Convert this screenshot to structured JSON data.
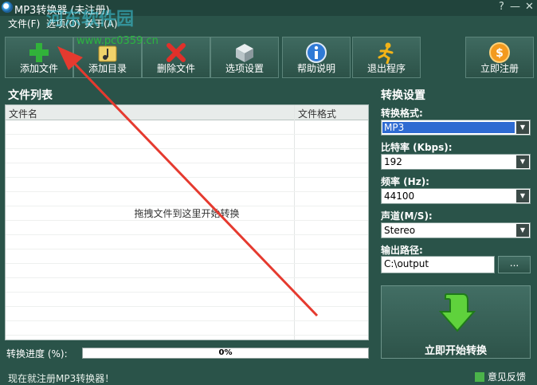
{
  "window": {
    "title": "MP3转换器 (未注册)",
    "help_glyph": "?",
    "minimize_glyph": "—",
    "close_glyph": "✕"
  },
  "watermark": {
    "name": "河东软件园",
    "url": "www.pc0359.cn"
  },
  "menu": [
    "文件(F)",
    "选项(O)",
    "关于(A)"
  ],
  "toolbar": {
    "add_file": "添加文件",
    "add_dir": "添加目录",
    "delete_file": "删除文件",
    "options": "选项设置",
    "help": "帮助说明",
    "exit": "退出程序",
    "register": "立即注册"
  },
  "file_list": {
    "title": "文件列表",
    "columns": [
      "文件名",
      "文件格式"
    ],
    "drop_hint": "拖拽文件到这里开始转换"
  },
  "progress": {
    "label": "转换进度 (%):",
    "value": 0,
    "text": "0%"
  },
  "settings": {
    "title": "转换设置",
    "format_label": "转换格式:",
    "format_value": "MP3",
    "bitrate_label": "比特率 (Kbps):",
    "bitrate_value": "192",
    "freq_label": "频率 (Hz):",
    "freq_value": "44100",
    "channel_label": "声道(M/S):",
    "channel_value": "Stereo",
    "output_label": "输出路径:",
    "output_value": "C:\\output",
    "browse_label": "...",
    "start_label": "立即开始转换"
  },
  "status": {
    "text": "现在就注册MP3转换器！",
    "feedback": "意见反馈"
  },
  "colors": {
    "background": "#2a5349",
    "accent_green": "#3a9d4b",
    "annotation_arrow": "#e53a2f"
  }
}
